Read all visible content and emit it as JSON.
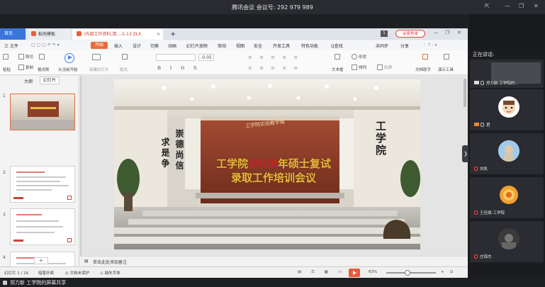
{
  "meeting": {
    "title": "腾讯会议 会议号: 292 979 989",
    "share_caption": "郑力新 工学院的屏幕共享",
    "speaker_label": "正在讲话:"
  },
  "wps": {
    "tabs": {
      "home": "首页",
      "tab1": "稻壳模板",
      "tab2": "(内部工作资料,请...-5-13 ZLX"
    },
    "add_tab": "+",
    "page_badge": "1",
    "login": "话客登录",
    "menu": {
      "file": "三 文件",
      "start": "开始",
      "items": [
        "插入",
        "设计",
        "切换",
        "动画",
        "幻灯片放映",
        "审阅",
        "视图",
        "安全",
        "开发工具",
        "特色功能",
        "Q查找"
      ],
      "right": [
        "未同步",
        "分享"
      ]
    },
    "ribbon": {
      "cut": "剪切",
      "copy": "复制",
      "paste": "粘贴",
      "format_painter": "格式刷",
      "play_from_current": "从当前开始",
      "new_slide": "新建幻灯片",
      "layout": "版式",
      "font_size": "-0.05",
      "textbox": "文本框",
      "shape": "形状",
      "arrange": "排列",
      "outline": "轮廓",
      "doc_assistant": "文档助手",
      "presentation_tools": "演示工具"
    },
    "panel": {
      "outline_tab": "大纲",
      "slides_tab": "幻灯片",
      "thumb_numbers": [
        "1",
        "2",
        "3",
        "4"
      ],
      "add": "+"
    },
    "slide": {
      "banner_left": "工学院",
      "banner_year": "2020",
      "banner_right": "年硕士复试",
      "banner_line2": "录取工作培训会议",
      "wall_right": "工学院",
      "wall_left_1": "崇德尚信",
      "wall_left_2": "求是争",
      "sign": "工学院实验教学楼"
    },
    "notes_placeholder": "单击此处添加备注",
    "status": {
      "slide_count": "幻灯片 1 / 16",
      "theme": "暗香扑面",
      "doc_protect": "文档未保护",
      "missing_font": "缺失字体",
      "zoom": "63%"
    }
  },
  "participants": [
    {
      "name": "郑力新 工学院的...",
      "avatar_color": "#3a3b40"
    },
    {
      "name": "君",
      "avatar_color": "#ffffff"
    },
    {
      "name": "刘凯",
      "avatar_color": "#8fc0e8"
    },
    {
      "name": "王佳斌-工学院",
      "avatar_color": "#e8a030"
    },
    {
      "name": "庄锦杰",
      "avatar_color": "#555555"
    }
  ]
}
